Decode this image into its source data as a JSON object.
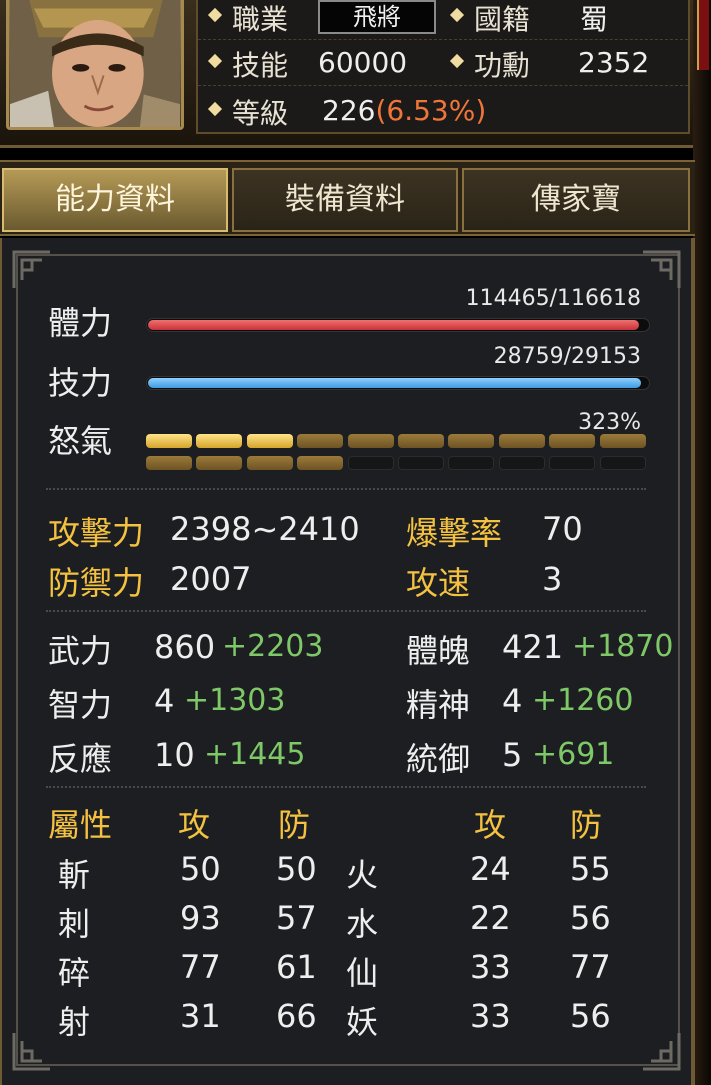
{
  "header": {
    "job_label": "職業",
    "job_value": "飛將",
    "nation_label": "國籍",
    "nation_value": "蜀",
    "skill_label": "技能",
    "skill_value": "60000",
    "merit_label": "功勳",
    "merit_value": "2352",
    "level_label": "等級",
    "level_value": "226",
    "level_pct": "(6.53%)"
  },
  "tabs": [
    {
      "label": "能力資料",
      "active": true
    },
    {
      "label": "裝備資料",
      "active": false
    },
    {
      "label": "傳家寶",
      "active": false
    }
  ],
  "bars": {
    "hp": {
      "label": "體力",
      "text": "114465/116618",
      "fraction": 0.9815
    },
    "mp": {
      "label": "技力",
      "text": "28759/29153",
      "fraction": 0.9865
    },
    "rage": {
      "label": "怒氣",
      "text": "323%",
      "segments_top": [
        "on",
        "on",
        "on",
        "mid",
        "mid",
        "mid",
        "mid",
        "mid",
        "mid",
        "mid"
      ],
      "segments_bottom": [
        "mid",
        "mid",
        "mid",
        "mid",
        "off",
        "off",
        "off",
        "off",
        "off",
        "off"
      ]
    }
  },
  "combat": {
    "attack_label": "攻擊力",
    "attack_value": "2398~2410",
    "crit_label": "爆擊率",
    "crit_value": "70",
    "defense_label": "防禦力",
    "defense_value": "2007",
    "speed_label": "攻速",
    "speed_value": "3"
  },
  "attributes": {
    "str_label": "武力",
    "str_value": "860",
    "str_bonus": "+2203",
    "con_label": "體魄",
    "con_value": "421",
    "con_bonus": "+1870",
    "int_label": "智力",
    "int_value": "4",
    "int_bonus": "+1303",
    "spi_label": "精神",
    "spi_value": "4",
    "spi_bonus": "+1260",
    "ref_label": "反應",
    "ref_value": "10",
    "ref_bonus": "+1445",
    "lead_label": "統御",
    "lead_value": "5",
    "lead_bonus": "+691"
  },
  "elements": {
    "header_attr": "屬性",
    "header_atk": "攻",
    "header_def": "防",
    "header_atk2": "攻",
    "header_def2": "防",
    "left": [
      {
        "name": "斬",
        "atk": "50",
        "def": "50"
      },
      {
        "name": "刺",
        "atk": "93",
        "def": "57"
      },
      {
        "name": "碎",
        "atk": "77",
        "def": "61"
      },
      {
        "name": "射",
        "atk": "31",
        "def": "66"
      }
    ],
    "right": [
      {
        "name": "火",
        "atk": "24",
        "def": "55"
      },
      {
        "name": "水",
        "atk": "22",
        "def": "56"
      },
      {
        "name": "仙",
        "atk": "33",
        "def": "77"
      },
      {
        "name": "妖",
        "atk": "33",
        "def": "56"
      }
    ]
  },
  "colors": {
    "gold": "#f4c240",
    "green": "#7fc868",
    "orange": "#f0753a",
    "hp": "#d8404a",
    "mp": "#4aa8e8"
  }
}
